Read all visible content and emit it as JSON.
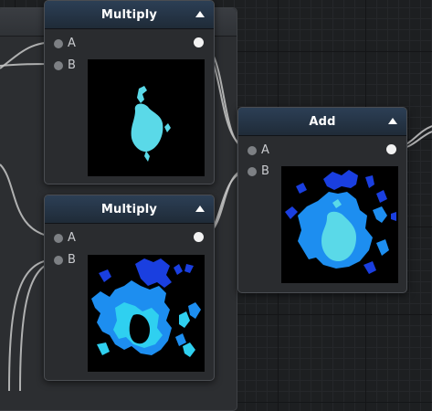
{
  "nodes": {
    "multiply_top": {
      "title": "Multiply",
      "inputs": [
        {
          "label": "A"
        },
        {
          "label": "B"
        }
      ],
      "preview_color": "#5ad9e8"
    },
    "multiply_bottom": {
      "title": "Multiply",
      "inputs": [
        {
          "label": "A"
        },
        {
          "label": "B"
        }
      ],
      "preview_colors": [
        "#1a3fe0",
        "#1d8ef0",
        "#2fd0f0",
        "#5ad9e8"
      ]
    },
    "add": {
      "title": "Add",
      "inputs": [
        {
          "label": "A"
        },
        {
          "label": "B"
        }
      ],
      "preview_colors": [
        "#1a3fe0",
        "#1d8ef0",
        "#5ad9e8"
      ]
    }
  },
  "colors": {
    "canvas_bg": "#1d1f21",
    "node_header": "#2c3f55",
    "wire": "#c8c8c8"
  }
}
